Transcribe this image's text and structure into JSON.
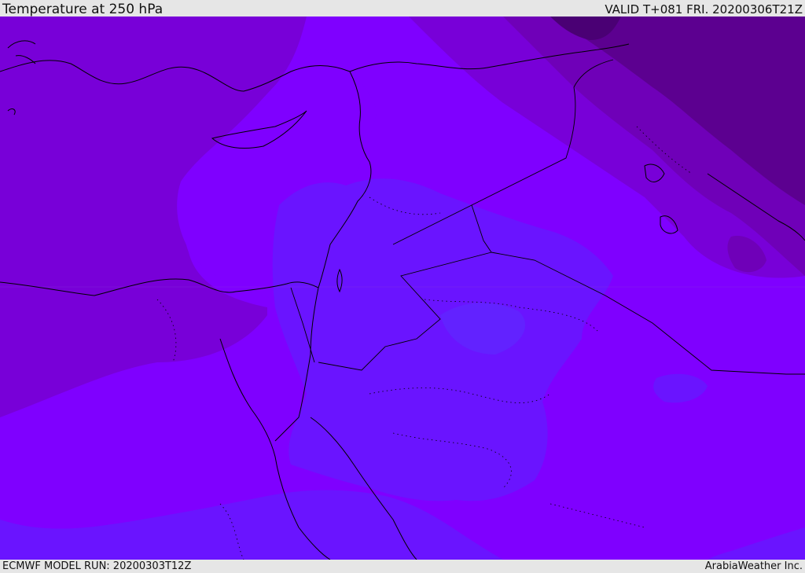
{
  "header": {
    "title": "Temperature at 250 hPa",
    "valid": "VALID T+081 FRI. 20200306T21Z"
  },
  "footer": {
    "model_run": "ECMWF MODEL RUN: 20200303T12Z",
    "credit": "ArabiaWeather Inc."
  },
  "colors": {
    "warm_band": "#7f00ff",
    "cool_band": "#6a14ff",
    "cold_band": "#7800d8",
    "colder_band": "#6f00b8",
    "coldest_band": "#5c0090",
    "coastline": "#000000"
  }
}
